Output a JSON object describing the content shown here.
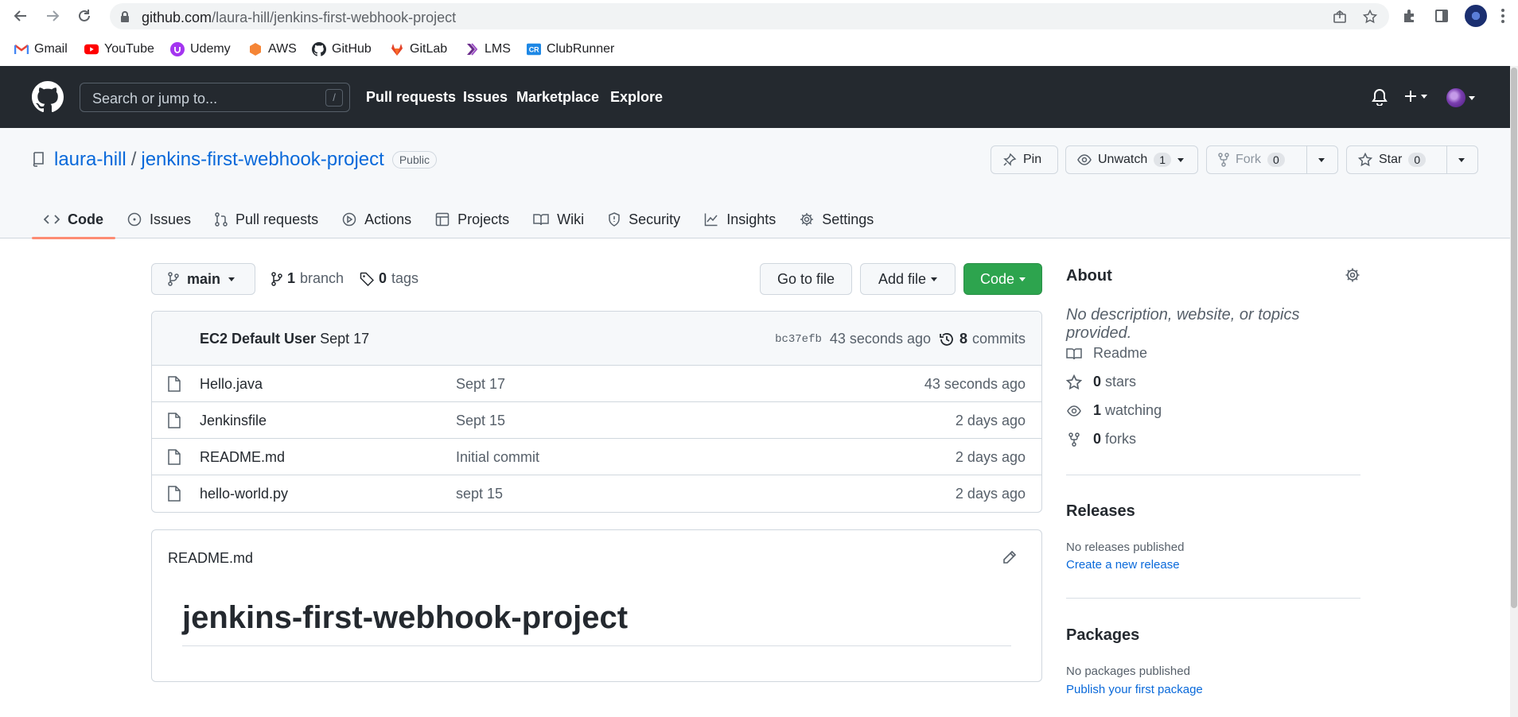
{
  "browser": {
    "url_host": "github.com",
    "url_path": "/laura-hill/jenkins-first-webhook-project",
    "bookmarks": [
      {
        "label": "Gmail",
        "icon": "gmail-icon"
      },
      {
        "label": "YouTube",
        "icon": "youtube-icon"
      },
      {
        "label": "Udemy",
        "icon": "udemy-icon"
      },
      {
        "label": "AWS",
        "icon": "aws-icon"
      },
      {
        "label": "GitHub",
        "icon": "github-icon"
      },
      {
        "label": "GitLab",
        "icon": "gitlab-icon"
      },
      {
        "label": "LMS",
        "icon": "lms-icon"
      },
      {
        "label": "ClubRunner",
        "icon": "clubrunner-icon"
      }
    ]
  },
  "header": {
    "search_placeholder": "Search or jump to...",
    "search_shortcut": "/",
    "nav": [
      "Pull requests",
      "Issues",
      "Marketplace",
      "Explore"
    ]
  },
  "repo": {
    "owner": "laura-hill",
    "separator": "/",
    "name": "jenkins-first-webhook-project",
    "visibility": "Public",
    "pin_label": "Pin",
    "unwatch_label": "Unwatch",
    "watch_count": "1",
    "fork_label": "Fork",
    "fork_count": "0",
    "star_label": "Star",
    "star_count": "0"
  },
  "tabs": [
    "Code",
    "Issues",
    "Pull requests",
    "Actions",
    "Projects",
    "Wiki",
    "Security",
    "Insights",
    "Settings"
  ],
  "toolbar": {
    "branch": "main",
    "branch_count": "1",
    "branch_word": "branch",
    "tag_count": "0",
    "tag_word": "tags",
    "go_to_file": "Go to file",
    "add_file": "Add file",
    "code": "Code"
  },
  "latest_commit": {
    "author": "EC2 Default User",
    "message": "Sept 17",
    "sha": "bc37efb",
    "age": "43 seconds ago",
    "commit_count": "8",
    "commit_word": "commits"
  },
  "files": [
    {
      "name": "Hello.java",
      "message": "Sept 17",
      "age": "43 seconds ago"
    },
    {
      "name": "Jenkinsfile",
      "message": "Sept 15",
      "age": "2 days ago"
    },
    {
      "name": "README.md",
      "message": "Initial commit",
      "age": "2 days ago"
    },
    {
      "name": "hello-world.py",
      "message": "sept 15",
      "age": "2 days ago"
    }
  ],
  "readme": {
    "filename": "README.md",
    "heading": "jenkins-first-webhook-project"
  },
  "sidebar": {
    "about_title": "About",
    "description": "No description, website, or topics provided.",
    "readme_label": "Readme",
    "stars_count": "0",
    "stars_word": "stars",
    "watching_count": "1",
    "watching_word": "watching",
    "forks_count": "0",
    "forks_word": "forks",
    "releases_title": "Releases",
    "releases_empty": "No releases published",
    "releases_link": "Create a new release",
    "packages_title": "Packages",
    "packages_empty": "No packages published",
    "packages_link": "Publish your first package"
  },
  "colors": {
    "header_bg": "#24292f",
    "link": "#0969da",
    "code_button": "#2da44e",
    "active_tab_underline": "#fd8c73"
  }
}
